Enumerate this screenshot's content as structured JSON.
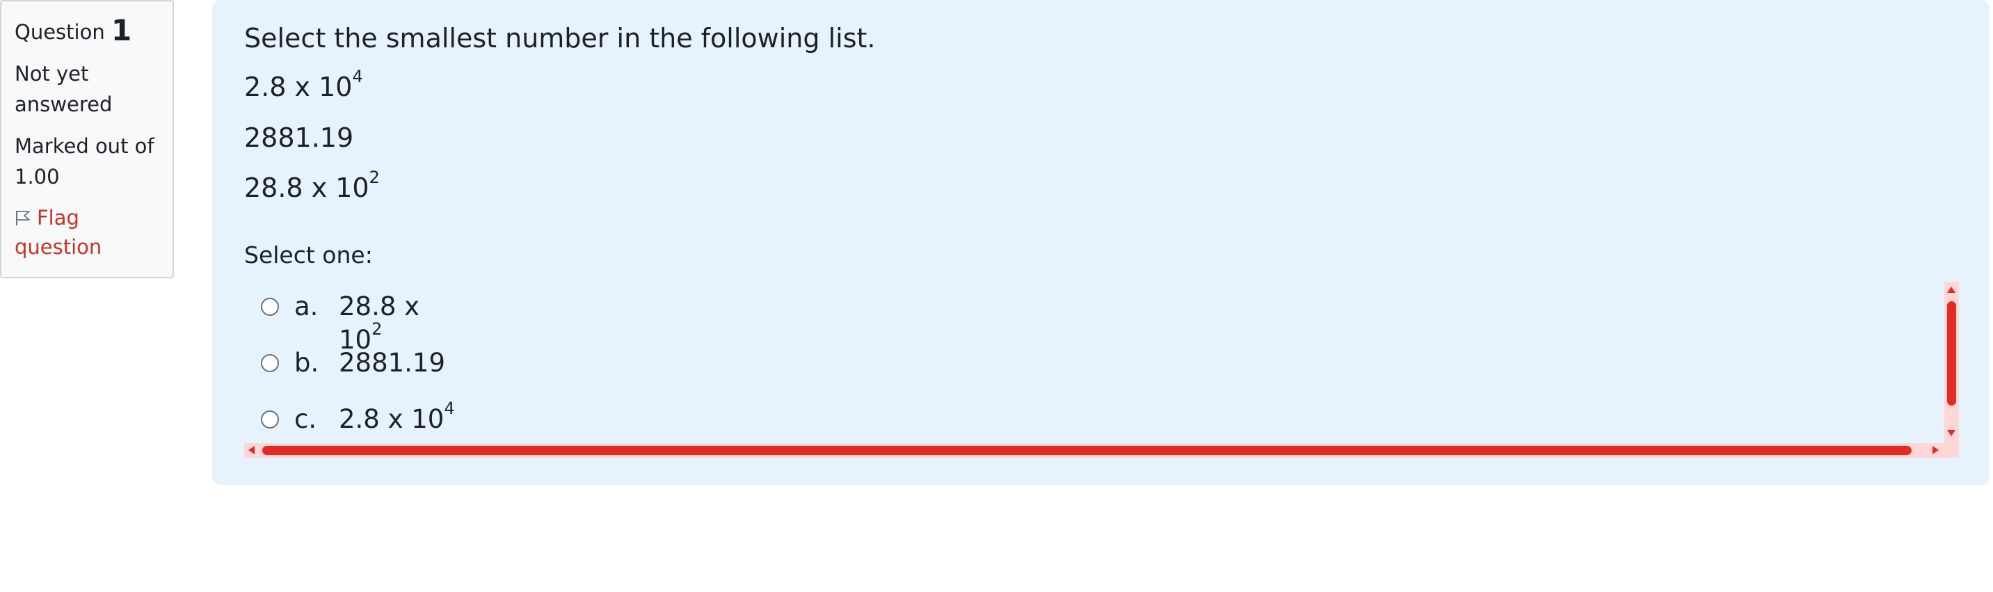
{
  "info": {
    "question_label": "Question",
    "question_number": "1",
    "state": "Not yet answered",
    "grade": "Marked out of 1.00",
    "flag_label": "Flag question"
  },
  "question": {
    "text": "Select the smallest number in the following list.",
    "items": [
      {
        "base": "2.8 x 10",
        "exponent": "4"
      },
      {
        "base": "2881.19",
        "exponent": ""
      },
      {
        "base": "28.8 x 10",
        "exponent": "2"
      }
    ],
    "prompt": "Select one:"
  },
  "answers": [
    {
      "letter": "a.",
      "text": "28.8 x 10",
      "exponent": "2",
      "selected": false
    },
    {
      "letter": "b.",
      "text": "2881.19",
      "exponent": "",
      "selected": false
    },
    {
      "letter": "c.",
      "text": "2.8 x 10",
      "exponent": "4",
      "selected": false
    }
  ],
  "colors": {
    "flag_link": "#ca3120",
    "content_background": "#e7f3fc",
    "scrollbar_thumb": "#e32a25",
    "scrollbar_track": "#ffd7d7"
  }
}
